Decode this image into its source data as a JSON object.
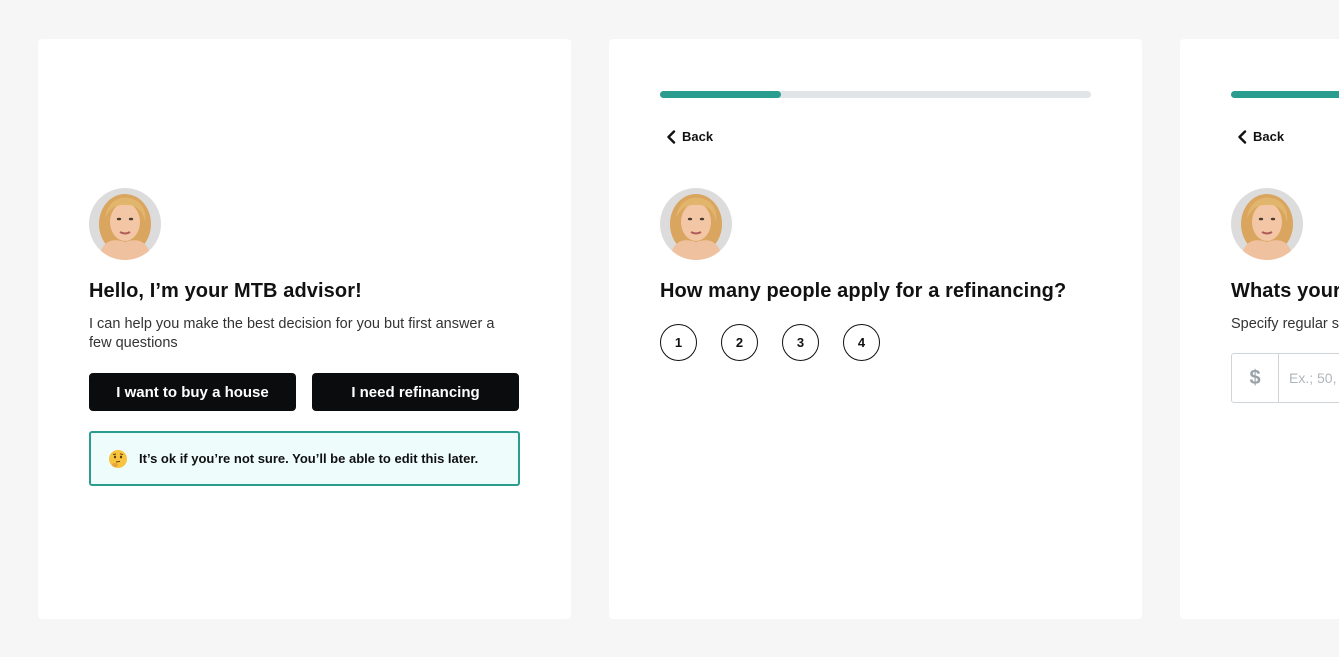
{
  "colors": {
    "accent": "#2a9d8f",
    "button_bg": "#0b0c0d",
    "note_bg": "#eefcfb"
  },
  "step1": {
    "title": "Hello, I’m your MTB advisor!",
    "subtitle": "I can help you make the best decision for you but first answer a few questions",
    "buy_label": "I want to buy a house",
    "refi_label": "I need refinancing",
    "note_icon": "thinking-face-icon",
    "note_text": "It’s ok if you’re not sure. You’ll be able to edit this later."
  },
  "step2": {
    "progress": 0.28,
    "back_label": "Back",
    "question": "How many people apply for a refinancing?",
    "options": [
      "1",
      "2",
      "3",
      "4"
    ]
  },
  "step3": {
    "progress": 0.28,
    "back_label": "Back",
    "question": "Whats your",
    "hint": "Specify regular s",
    "currency_symbol": "$",
    "placeholder": "Ex.; 50,"
  }
}
